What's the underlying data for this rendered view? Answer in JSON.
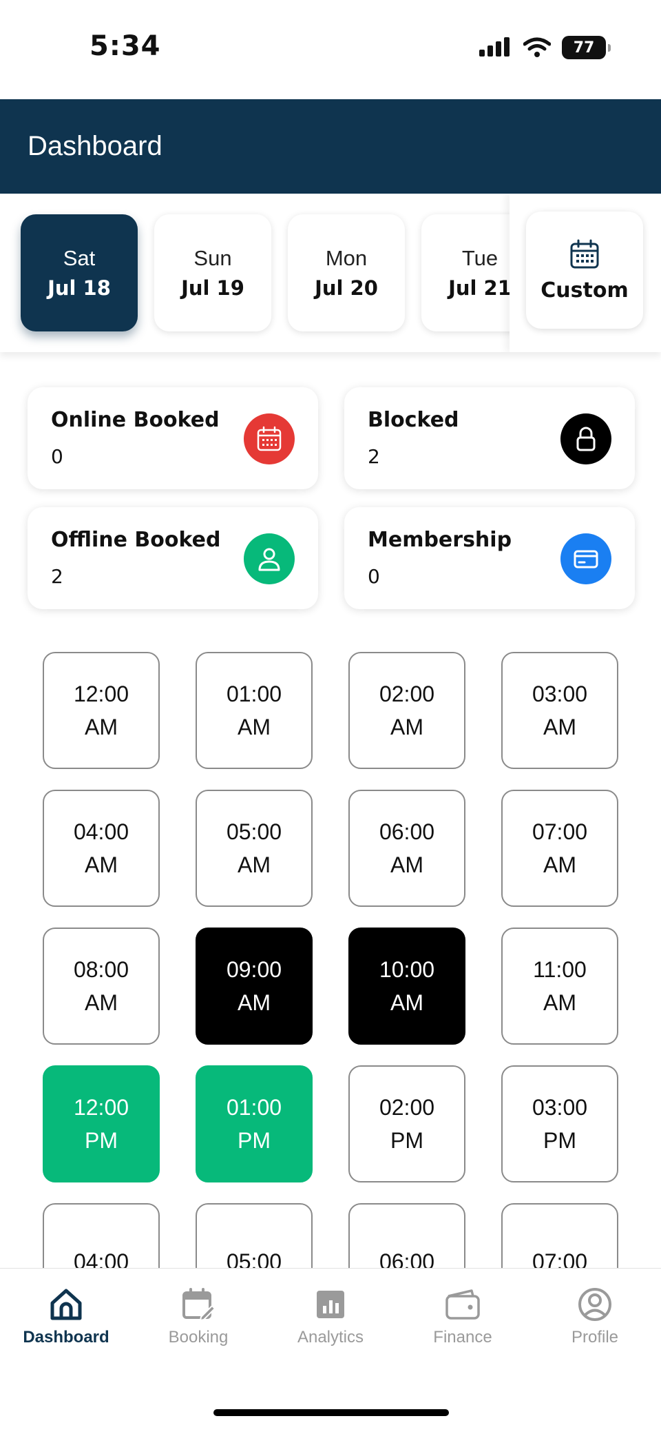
{
  "status_bar": {
    "time": "5:34",
    "battery": "77"
  },
  "header": {
    "title": "Dashboard"
  },
  "dates": [
    {
      "day": "Sat",
      "date": "Jul 18",
      "selected": true
    },
    {
      "day": "Sun",
      "date": "Jul 19",
      "selected": false
    },
    {
      "day": "Mon",
      "date": "Jul 20",
      "selected": false
    },
    {
      "day": "Tue",
      "date": "Jul 21",
      "selected": false
    }
  ],
  "custom": {
    "label": "Custom",
    "icon": "calendar-icon"
  },
  "stats": [
    {
      "label": "Online Booked",
      "value": "0",
      "icon": "calendar-icon",
      "color": "#e53935"
    },
    {
      "label": "Blocked",
      "value": "2",
      "icon": "lock-icon",
      "color": "#000000"
    },
    {
      "label": "Offline Booked",
      "value": "2",
      "icon": "person-icon",
      "color": "#07b97a"
    },
    {
      "label": "Membership",
      "value": "0",
      "icon": "card-icon",
      "color": "#1a7ff2"
    }
  ],
  "slots": [
    {
      "time": "12:00",
      "period": "AM",
      "status": "available"
    },
    {
      "time": "01:00",
      "period": "AM",
      "status": "available"
    },
    {
      "time": "02:00",
      "period": "AM",
      "status": "available"
    },
    {
      "time": "03:00",
      "period": "AM",
      "status": "available"
    },
    {
      "time": "04:00",
      "period": "AM",
      "status": "available"
    },
    {
      "time": "05:00",
      "period": "AM",
      "status": "available"
    },
    {
      "time": "06:00",
      "period": "AM",
      "status": "available"
    },
    {
      "time": "07:00",
      "period": "AM",
      "status": "available"
    },
    {
      "time": "08:00",
      "period": "AM",
      "status": "available"
    },
    {
      "time": "09:00",
      "period": "AM",
      "status": "blocked"
    },
    {
      "time": "10:00",
      "period": "AM",
      "status": "blocked"
    },
    {
      "time": "11:00",
      "period": "AM",
      "status": "available"
    },
    {
      "time": "12:00",
      "period": "PM",
      "status": "offline"
    },
    {
      "time": "01:00",
      "period": "PM",
      "status": "offline"
    },
    {
      "time": "02:00",
      "period": "PM",
      "status": "available"
    },
    {
      "time": "03:00",
      "period": "PM",
      "status": "available"
    },
    {
      "time": "04:00",
      "period": "",
      "status": "available"
    },
    {
      "time": "05:00",
      "period": "",
      "status": "available"
    },
    {
      "time": "06:00",
      "period": "",
      "status": "available"
    },
    {
      "time": "07:00",
      "period": "",
      "status": "available"
    }
  ],
  "nav": [
    {
      "label": "Dashboard",
      "icon": "home-icon",
      "active": true
    },
    {
      "label": "Booking",
      "icon": "calendar-edit-icon",
      "active": false
    },
    {
      "label": "Analytics",
      "icon": "analytics-icon",
      "active": false
    },
    {
      "label": "Finance",
      "icon": "wallet-icon",
      "active": false
    },
    {
      "label": "Profile",
      "icon": "profile-icon",
      "active": false
    }
  ],
  "colors": {
    "primary": "#0f344f",
    "blocked": "#000000",
    "offline": "#07b97a"
  }
}
